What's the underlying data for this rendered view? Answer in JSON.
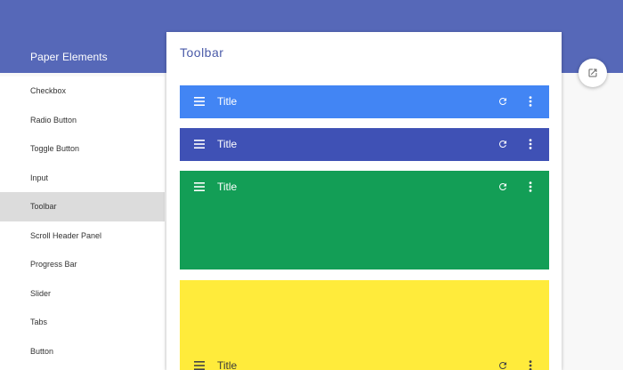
{
  "sidebar": {
    "title": "Paper Elements",
    "items": [
      {
        "label": "Checkbox"
      },
      {
        "label": "Radio Button"
      },
      {
        "label": "Toggle Button"
      },
      {
        "label": "Input"
      },
      {
        "label": "Toolbar",
        "selected": true
      },
      {
        "label": "Scroll Header Panel"
      },
      {
        "label": "Progress Bar"
      },
      {
        "label": "Slider"
      },
      {
        "label": "Tabs"
      },
      {
        "label": "Button"
      }
    ]
  },
  "main": {
    "title": "Toolbar",
    "toolbars": [
      {
        "title": "Title",
        "color": "#4285f4",
        "menu_icon": "menu-icon",
        "refresh_icon": "refresh-icon",
        "more_icon": "more-vert-icon"
      },
      {
        "title": "Title",
        "color": "#3f51b5",
        "menu_icon": "menu-icon",
        "refresh_icon": "refresh-icon",
        "more_icon": "more-vert-icon"
      },
      {
        "title": "Title",
        "color": "#139e56",
        "menu_icon": "menu-icon",
        "refresh_icon": "refresh-icon",
        "more_icon": "more-vert-icon"
      },
      {
        "title": "Title",
        "color": "#ffeb3b",
        "menu_icon": "menu-icon",
        "refresh_icon": "refresh-icon",
        "more_icon": "more-vert-icon"
      }
    ]
  },
  "fab": {
    "icon": "open-in-new-icon"
  },
  "colors": {
    "header": "#5668b8",
    "selected_item": "#dcdcdc",
    "title_text": "#4a5aa8"
  }
}
